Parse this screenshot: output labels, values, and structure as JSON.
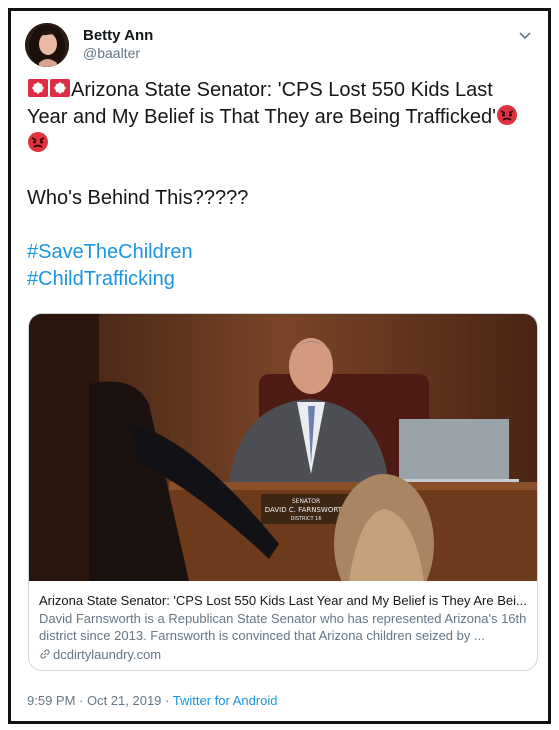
{
  "author": {
    "name": "Betty Ann",
    "handle": "@baalter"
  },
  "tweet": {
    "line1": "Arizona State Senator: 'CPS Lost 550 Kids Last Year and My Belief is That They are Being Trafficked'",
    "line2": "Who's Behind This?????",
    "hashtags": [
      "#SaveTheChildren",
      "#ChildTrafficking"
    ]
  },
  "card": {
    "image_nameplate": [
      "SENATOR",
      "DAVID C. FARNSWORTH",
      "DISTRICT 16"
    ],
    "title": "Arizona State Senator: 'CPS Lost 550 Kids Last Year and My Belief is They Are Bei...",
    "description": "David Farnsworth is a Republican State Senator who has represented Arizona's 16th district since 2013. Farnsworth is convinced that Arizona children seized by ...",
    "domain": "dcdirtylaundry.com"
  },
  "footer": {
    "timestamp": "9:59 PM · Oct 21, 2019",
    "separator": " · ",
    "source": "Twitter for Android"
  },
  "icons": [
    "siren-emoji",
    "angry-face-emoji",
    "chevron-down-icon",
    "link-icon"
  ],
  "colors": {
    "link": "#1b95e0",
    "secondary": "#657786",
    "text": "#14171a"
  }
}
